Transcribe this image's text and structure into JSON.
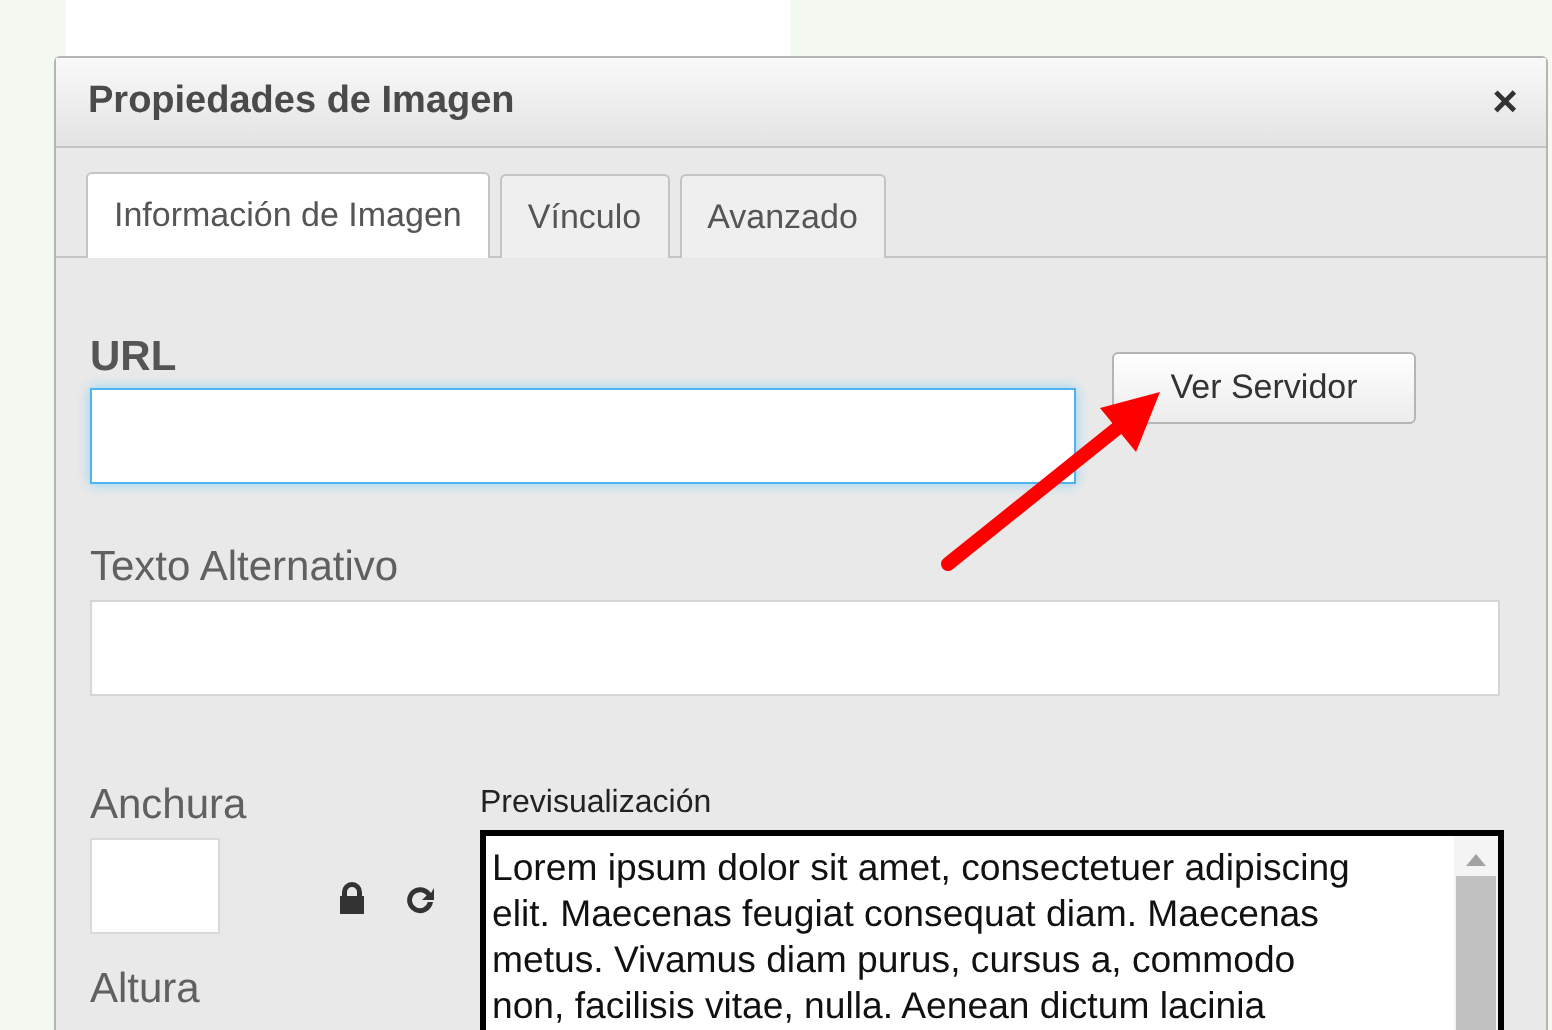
{
  "dialog": {
    "title": "Propiedades de Imagen",
    "close": "×"
  },
  "tabs": [
    {
      "label": "Información de Imagen",
      "selected": true
    },
    {
      "label": "Vínculo",
      "selected": false
    },
    {
      "label": "Avanzado",
      "selected": false
    }
  ],
  "url": {
    "label": "URL",
    "focused": true
  },
  "browse_button": "Ver Servidor",
  "alt_text": {
    "label": "Texto Alternativo"
  },
  "width": {
    "label": "Anchura"
  },
  "height": {
    "label": "Altura"
  },
  "preview": {
    "label": "Previsualización",
    "lines": [
      "Lorem ipsum dolor sit amet, consectetuer adipiscing",
      "elit. Maecenas feugiat consequat diam. Maecenas",
      "metus. Vivamus diam purus, cursus a, commodo",
      "non, facilisis vitae, nulla. Aenean dictum lacinia"
    ]
  }
}
